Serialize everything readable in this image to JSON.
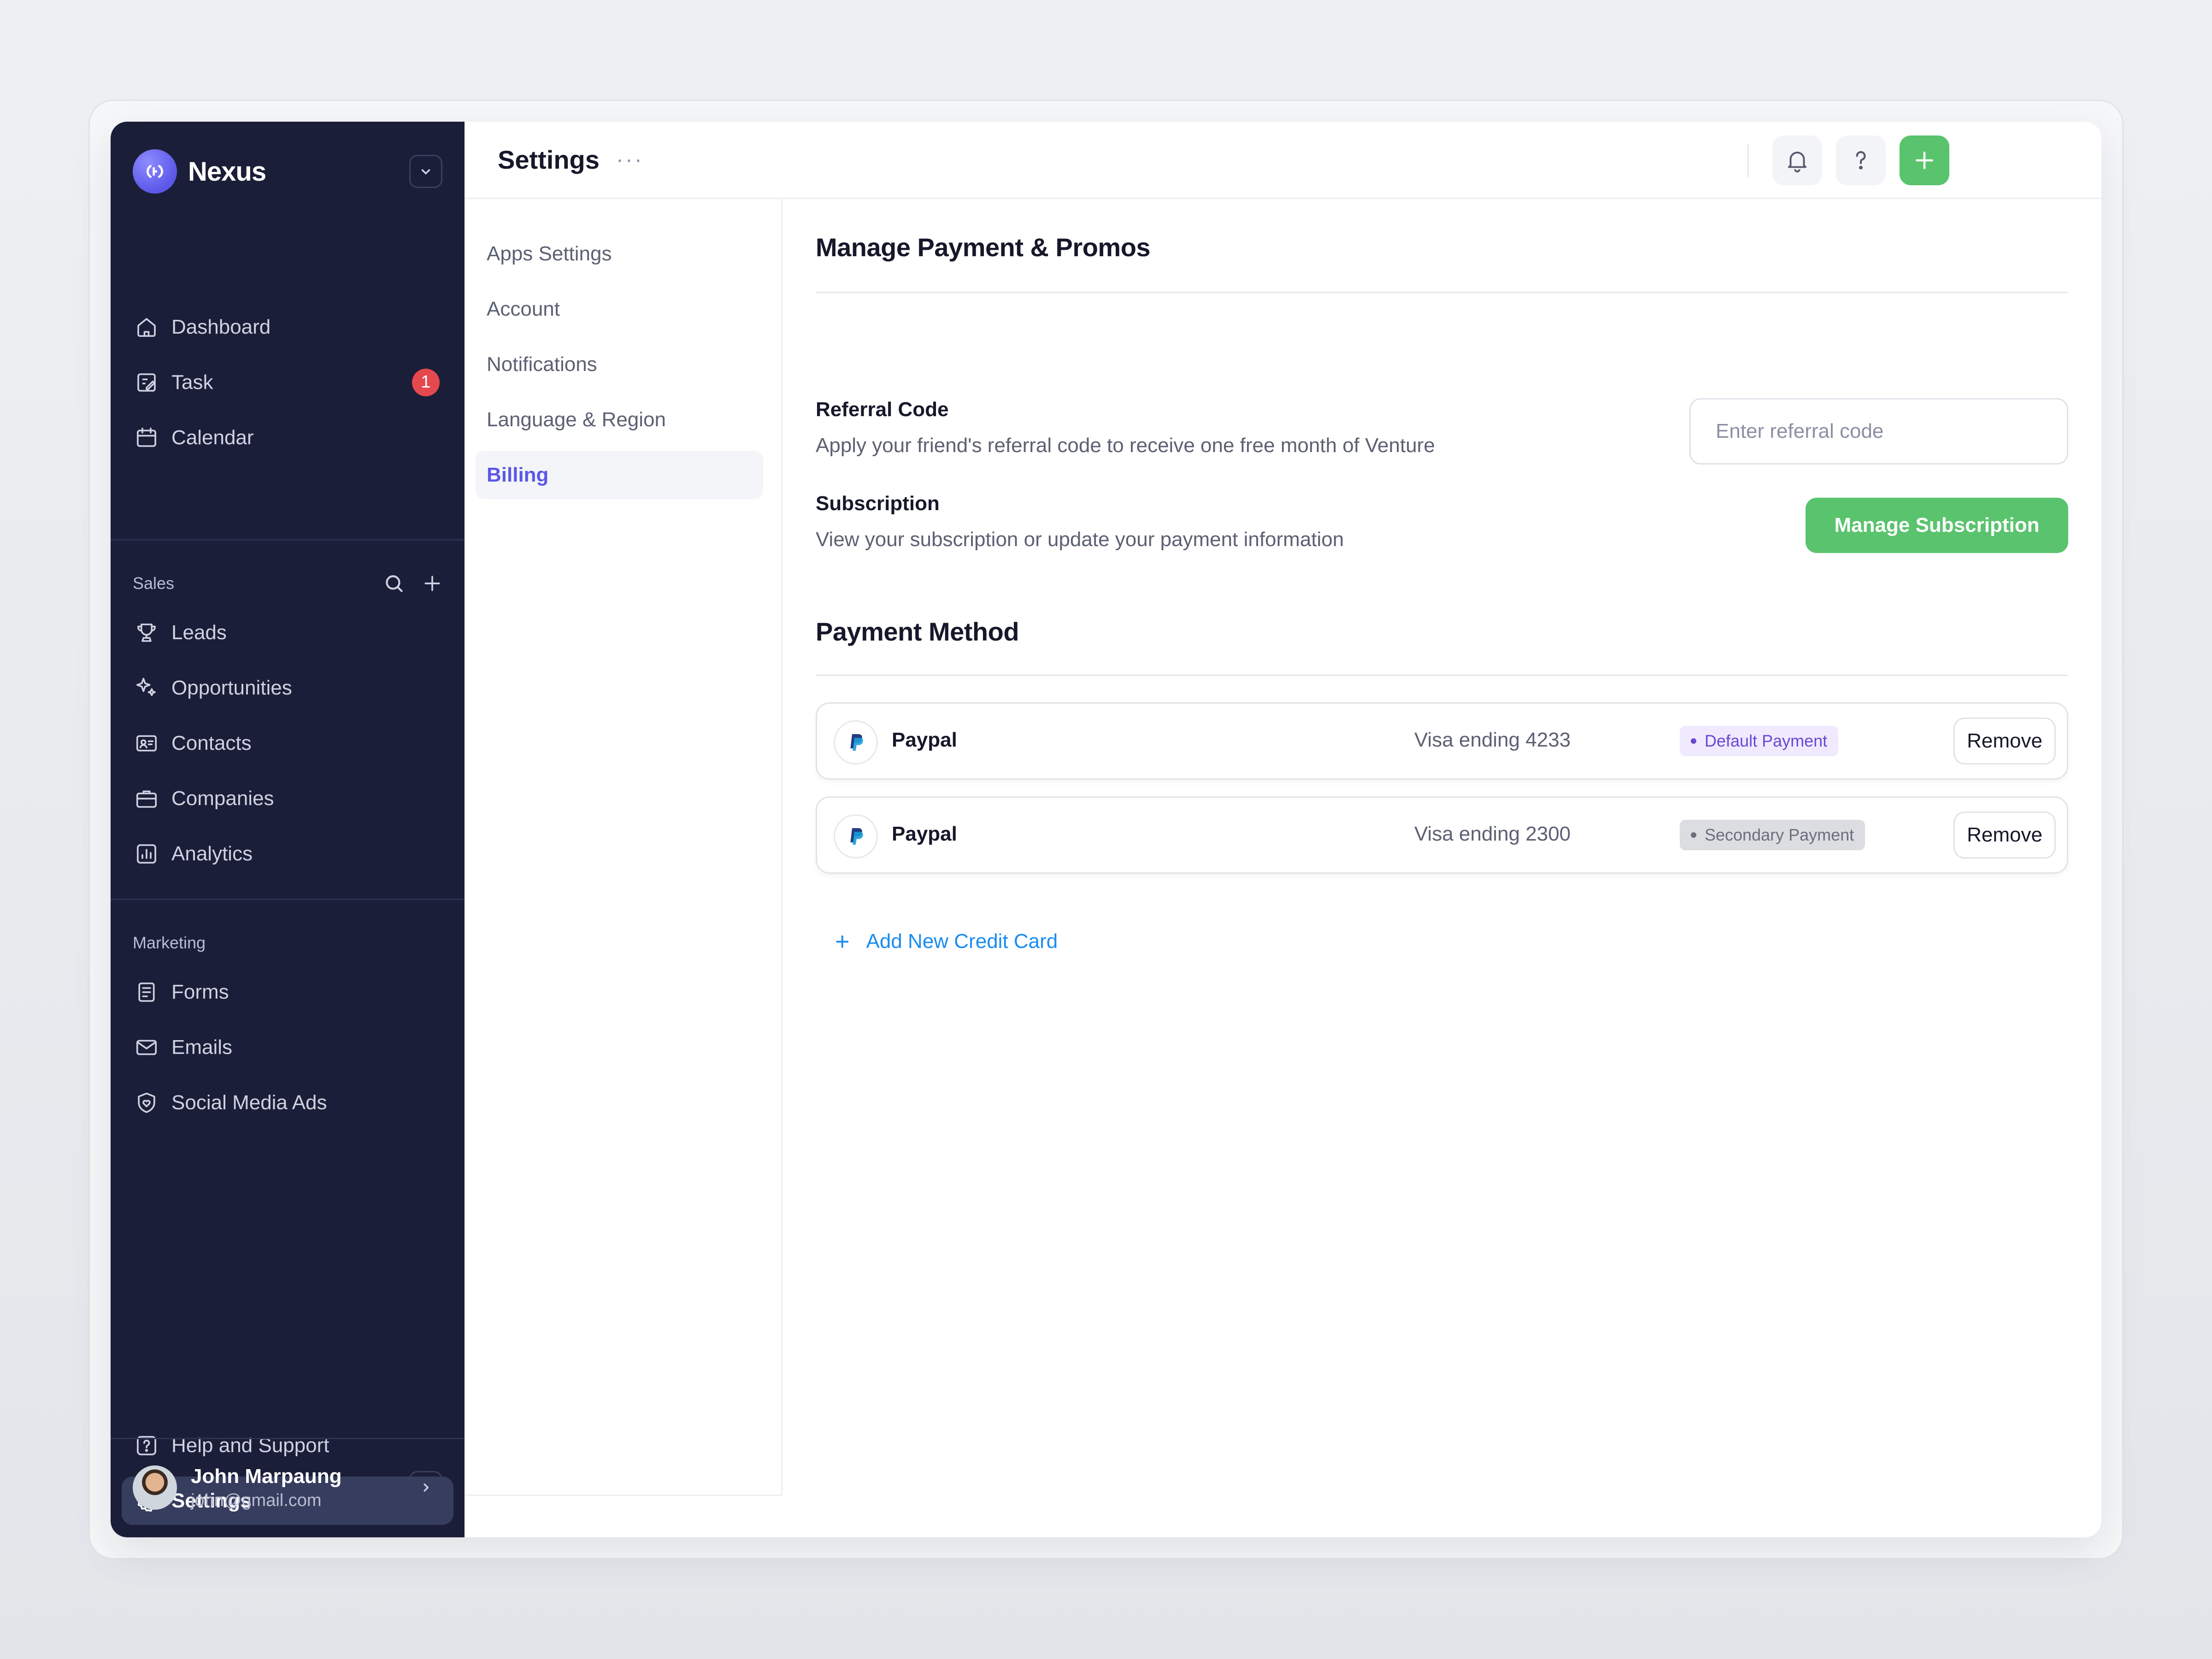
{
  "brand": {
    "name": "Nexus"
  },
  "sidebar": {
    "main_items": [
      {
        "label": "Dashboard",
        "icon": "home-icon"
      },
      {
        "label": "Task",
        "icon": "task-icon",
        "badge": "1"
      },
      {
        "label": "Calendar",
        "icon": "calendar-icon"
      }
    ],
    "sales": {
      "title": "Sales",
      "items": [
        {
          "label": "Leads",
          "icon": "trophy-icon"
        },
        {
          "label": "Opportunities",
          "icon": "sparkle-icon"
        },
        {
          "label": "Contacts",
          "icon": "contact-card-icon"
        },
        {
          "label": "Companies",
          "icon": "briefcase-icon"
        },
        {
          "label": "Analytics",
          "icon": "chart-icon"
        }
      ]
    },
    "marketing": {
      "title": "Marketing",
      "items": [
        {
          "label": "Forms",
          "icon": "form-icon"
        },
        {
          "label": "Emails",
          "icon": "mail-icon"
        },
        {
          "label": "Social Media Ads",
          "icon": "heart-shield-icon"
        }
      ]
    },
    "bottom_items": [
      {
        "label": "Help and Support",
        "icon": "help-icon"
      },
      {
        "label": "Settings",
        "icon": "gear-icon",
        "active": true
      }
    ],
    "user": {
      "name": "John Marpaung",
      "email": "john@gmail.com"
    }
  },
  "header": {
    "title": "Settings",
    "more": "···"
  },
  "settings_nav": {
    "items": [
      "Apps Settings",
      "Account",
      "Notifications",
      "Language & Region",
      "Billing"
    ],
    "active": "Billing"
  },
  "billing": {
    "section_title": "Manage Payment & Promos",
    "referral": {
      "title": "Referral Code",
      "description": "Apply your friend's referral code to receive one free month of Venture",
      "placeholder": "Enter referral code"
    },
    "subscription": {
      "title": "Subscription",
      "description": "View your subscription or update your payment information",
      "button": "Manage Subscription"
    },
    "payment_title": "Payment Method",
    "methods": [
      {
        "provider": "Paypal",
        "card": "Visa ending 4233",
        "status": "Default Payment",
        "action": "Remove"
      },
      {
        "provider": "Paypal",
        "card": "Visa ending 2300",
        "status": "Secondary Payment",
        "action": "Remove"
      }
    ],
    "add_card": "Add New Credit Card"
  },
  "colors": {
    "sidebar_bg": "#1b1e38",
    "accent_purple": "#5b57e8",
    "accent_green": "#5ac36e",
    "link_blue": "#1a8cf0",
    "badge_red": "#e5484d"
  }
}
